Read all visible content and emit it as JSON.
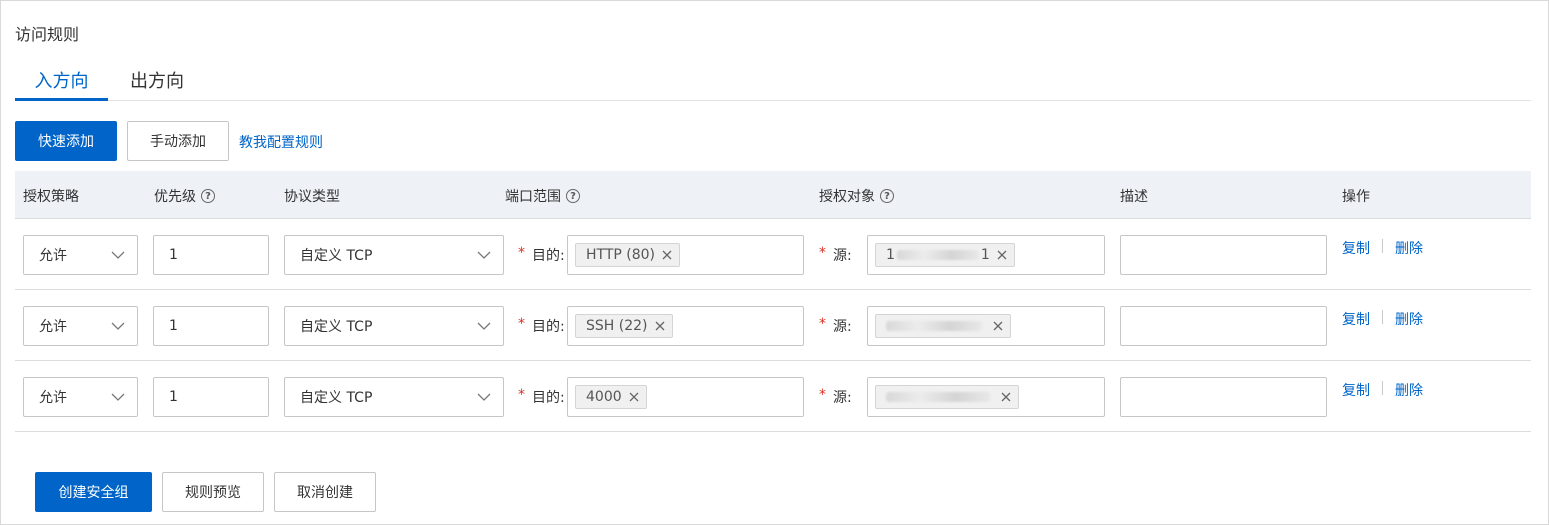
{
  "page": {
    "title": "访问规则"
  },
  "tabs": [
    {
      "label": "入方向",
      "active": true
    },
    {
      "label": "出方向",
      "active": false
    }
  ],
  "toolbar": {
    "quick_add": "快速添加",
    "manual_add": "手动添加",
    "teach_link": "教我配置规则"
  },
  "table": {
    "headers": {
      "policy": "授权策略",
      "priority": "优先级",
      "protocol": "协议类型",
      "port_range": "端口范围",
      "auth_object": "授权对象",
      "description": "描述",
      "actions": "操作"
    },
    "dest_label": "目的:",
    "source_label": "源:",
    "copy_label": "复制",
    "delete_label": "删除",
    "rows": [
      {
        "policy": "允许",
        "priority": "1",
        "protocol": "自定义 TCP",
        "port": "HTTP (80)",
        "source_prefix": "1",
        "source_suffix": "1"
      },
      {
        "policy": "允许",
        "priority": "1",
        "protocol": "自定义 TCP",
        "port": "SSH (22)",
        "source_prefix": "",
        "source_suffix": ""
      },
      {
        "policy": "允许",
        "priority": "1",
        "protocol": "自定义 TCP",
        "port": "4000",
        "source_prefix": "",
        "source_suffix": ""
      }
    ]
  },
  "footer": {
    "create": "创建安全组",
    "preview": "规则预览",
    "cancel": "取消创建"
  },
  "colors": {
    "accent": "#0064c8",
    "required": "#d93026",
    "header_bg": "#eef2f7"
  }
}
